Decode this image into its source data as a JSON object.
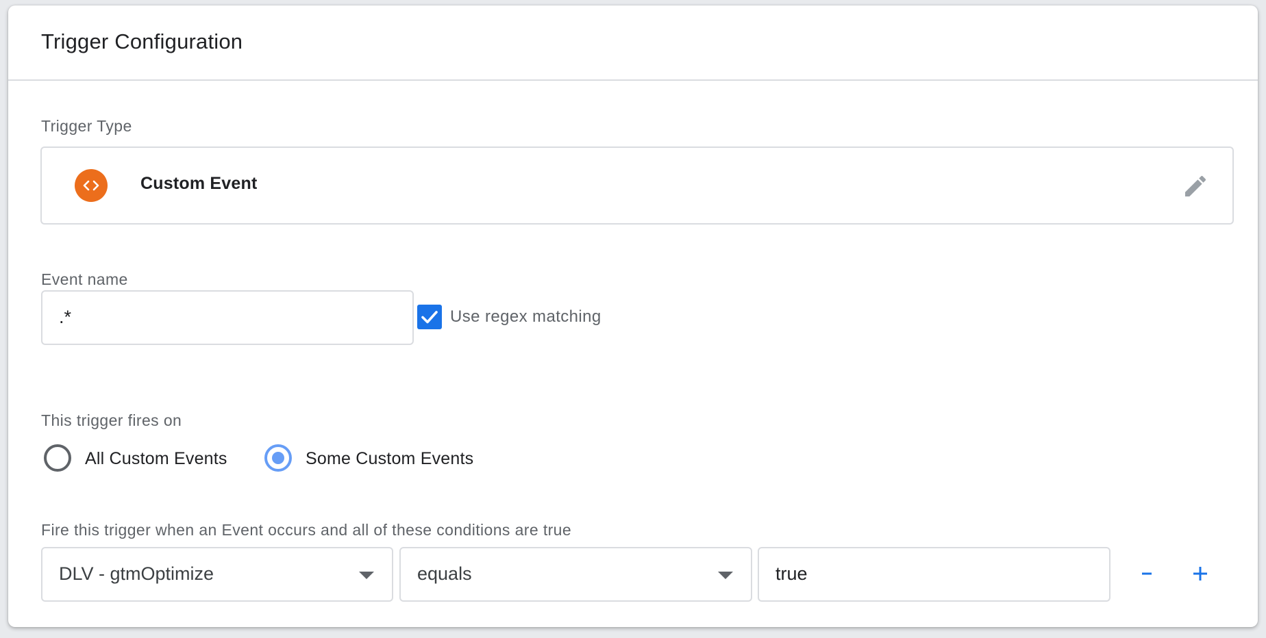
{
  "header": {
    "title": "Trigger Configuration"
  },
  "trigger_type": {
    "label": "Trigger Type",
    "name": "Custom Event",
    "icon": "code-brackets-icon",
    "icon_color": "#ec6e1c"
  },
  "event_name": {
    "label": "Event name",
    "value": ".*",
    "regex_checkbox_label": "Use regex matching",
    "regex_checked": true
  },
  "fires_on": {
    "label": "This trigger fires on",
    "options": [
      {
        "label": "All Custom Events",
        "selected": false
      },
      {
        "label": "Some Custom Events",
        "selected": true
      }
    ]
  },
  "conditions": {
    "label": "Fire this trigger when an Event occurs and all of these conditions are true",
    "rows": [
      {
        "variable": "DLV - gtmOptimize",
        "operator": "equals",
        "value": "true"
      }
    ],
    "remove_icon": "minus-icon",
    "add_icon": "plus-icon"
  },
  "colors": {
    "accent": "#1a73e8",
    "radio_selected": "#669df6",
    "border": "#dadce0"
  }
}
